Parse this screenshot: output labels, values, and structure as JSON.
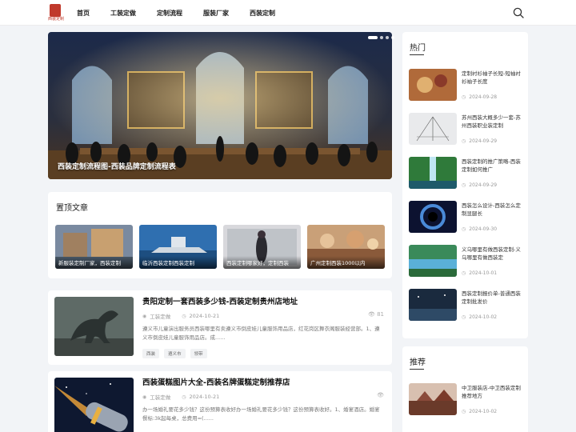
{
  "header": {
    "logo_text": "服装",
    "logo_sub": "西装定制",
    "nav": [
      "首页",
      "工装定做",
      "定制流程",
      "服装厂家",
      "西装定制"
    ]
  },
  "hero": {
    "caption": "西装定制流程图-西装品牌定制流程表"
  },
  "featured": {
    "title": "置顶文章",
    "items": [
      "新服装定制厂家，西装定制",
      "临沂西装定制西装定制",
      "西装定制哪家好，定制西装",
      "广州定制西装1000以内"
    ]
  },
  "posts": [
    {
      "title": "贵阳定制一套西装多少钱-西装定制贵州店地址",
      "category": "工装定做",
      "date": "2024-10-21",
      "views": "81",
      "excerpt": "遵义市儿童演出服务员西装哪里有卖遵义市倒皮娃儿童服饰用品店，红花岗区舞衣阁服装经营部。1、遵义市倒皮娃儿童服饰用品店。成......",
      "tags": [
        "西装",
        "遵义市",
        "领带"
      ]
    },
    {
      "title": "西装蛋糕图片大全-西装名牌蛋糕定制推荐店",
      "category": "工装定做",
      "date": "2024-10-21",
      "views": "",
      "excerpt": "办一场婚礼要花多少钱？这份预算表收好办一场婚礼要花多少钱？这份预算表收好。1、婚宴酒店。婚宴餐标:3k起每桌，总费用=(......",
      "tags": []
    }
  ],
  "sidebar": {
    "hot_title": "热门",
    "hot": [
      {
        "title": "定制衬衫袖子长短-短袖衬衫袖子长度",
        "date": "2024-09-28"
      },
      {
        "title": "苏州西装大概多少一套-苏州西装职业装定制",
        "date": "2024-09-29"
      },
      {
        "title": "西装定制的推广策略-西装定制如何推广",
        "date": "2024-09-29"
      },
      {
        "title": "西装怎么设计-西装怎么定制显腿长",
        "date": "2024-09-30"
      },
      {
        "title": "义乌哪里有做西装定制-义乌哪里有做西装定",
        "date": "2024-10-01"
      },
      {
        "title": "西装定制报价单-普通西装定制批发价",
        "date": "2024-10-02"
      }
    ],
    "rec_title": "推荐",
    "rec": [
      {
        "title": "中卫服装店-中卫西装定制推荐地方",
        "date": "2024-10-02"
      }
    ]
  }
}
